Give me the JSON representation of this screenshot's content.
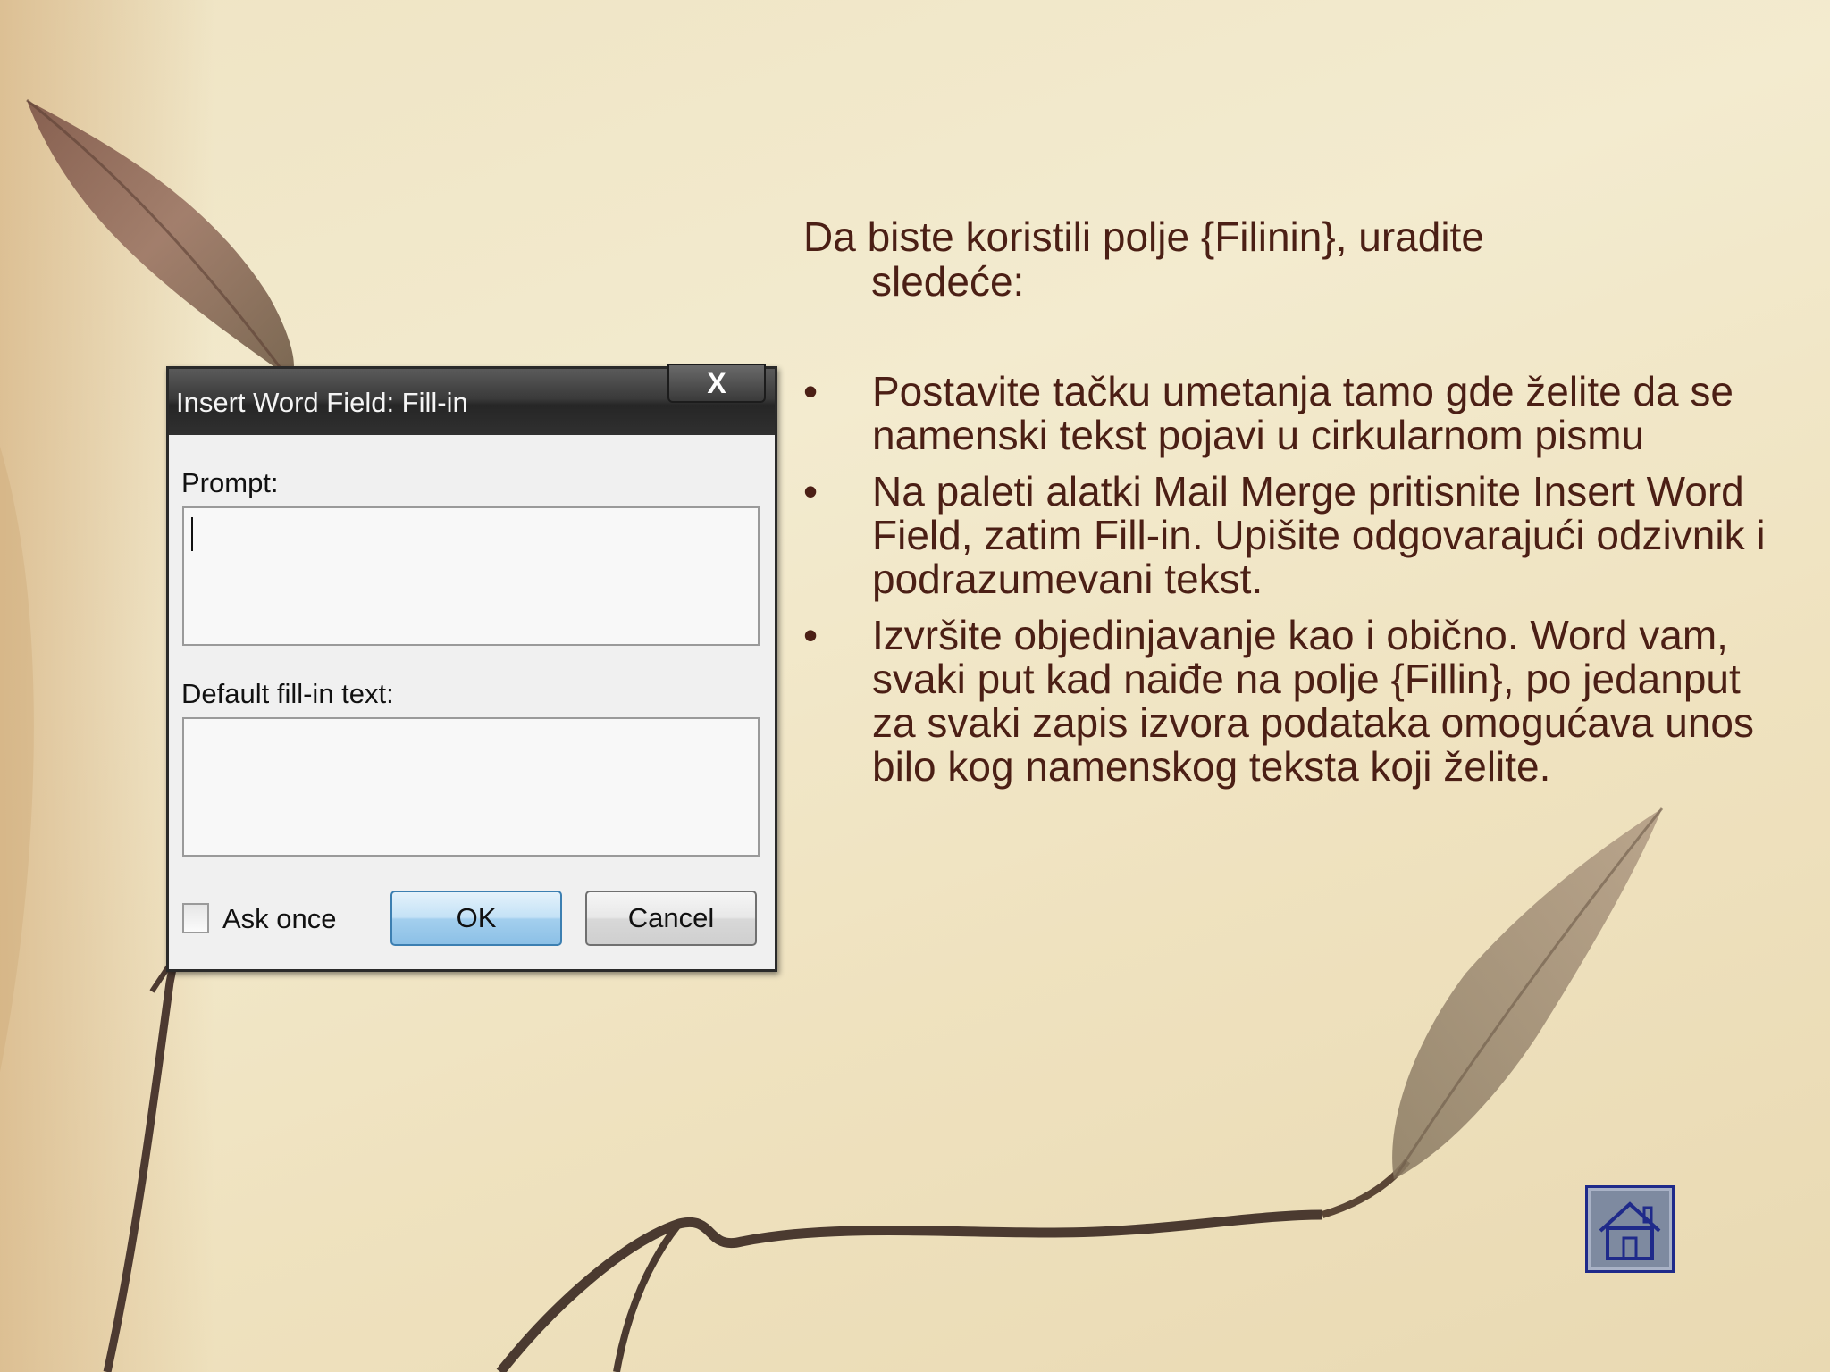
{
  "dialog": {
    "title": "Insert Word Field: Fill-in",
    "close_glyph": "X",
    "prompt_label": "Prompt:",
    "prompt_value": "",
    "default_label": "Default fill-in text:",
    "default_value": "",
    "ask_once_label": "Ask once",
    "ask_once_checked": false,
    "ok_label": "OK",
    "cancel_label": "Cancel"
  },
  "slide": {
    "intro_line1": "Da biste koristili polje {Filinin}, uradite",
    "intro_line2": "sledeće:",
    "bullets": [
      " Postavite tačku umetanja tamo gde želite da se namenski tekst pojavi u cirkularnom pismu",
      "Na paleti alatki Mail Merge pritisnite Insert Word Field, zatim Fill-in. Upišite odgovarajući odzivnik i podrazumevani tekst.",
      " Izvršite objedinjavanje kao i obično. Word vam, svaki put kad naiđe na polje {Fillin}, po jedanput za svaki zapis izvora podataka omogućava unos bilo kog namenskog teksta koji želite."
    ],
    "bullet_char": "•"
  },
  "home_button": {
    "icon": "home-icon"
  },
  "colors": {
    "text": "#4b1f15",
    "background": "#f2e9cc",
    "home_border": "#1f2a8a"
  }
}
